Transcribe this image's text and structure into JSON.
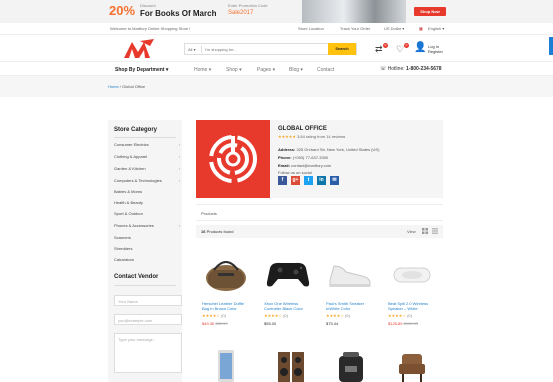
{
  "promo": {
    "percent": "20%",
    "discount": "Discount",
    "headline": "For Books Of March",
    "enter_code": "Enter Promotion Code",
    "code": "Sale2017",
    "shop_now": "Shop Now"
  },
  "topbar": {
    "welcome": "Welcome to Martfury Online Shopping Store !",
    "store_location": "Store Location",
    "track_order": "Track Your Order",
    "currency": "US Dollar",
    "language": "English"
  },
  "header": {
    "search_category": "All",
    "search_placeholder": "I'm shopping for...",
    "search_button": "Search",
    "compare_count": "0",
    "wishlist_count": "0",
    "login": "Log In",
    "register": "Register"
  },
  "nav": {
    "dept": "Shop By Department",
    "items": [
      "Home",
      "Shop",
      "Pages",
      "Blog",
      "Contact"
    ],
    "hotline_label": "Hotline:",
    "hotline": "1-800-234-5678"
  },
  "breadcrumb": {
    "home": "Home",
    "current": "Global Office"
  },
  "sidebar": {
    "category_title": "Store Category",
    "categories": [
      {
        "label": "Consumer Electrics",
        "chevron": true
      },
      {
        "label": "Clothing & Apparel",
        "chevron": true
      },
      {
        "label": "Garden & Kitchen",
        "chevron": true
      },
      {
        "label": "Computers & Technologies",
        "chevron": true
      },
      {
        "label": "Babies & Moms",
        "chevron": false
      },
      {
        "label": "Health & Beauty",
        "chevron": false
      },
      {
        "label": "Sport & Outdoor",
        "chevron": false
      },
      {
        "label": "Phones & Accessories",
        "chevron": true
      },
      {
        "label": "Scanners",
        "chevron": false
      },
      {
        "label": "Shredders",
        "chevron": false
      },
      {
        "label": "Calculators",
        "chevron": false
      }
    ],
    "vendor_title": "Contact Vendor",
    "name_placeholder": "Your Name",
    "email_placeholder": "you@example.com",
    "message_placeholder": "Type your message..."
  },
  "store": {
    "name": "GLOBAL OFFICE",
    "stars": "★★★★★",
    "rating": "3.84 rating from 14 reviews",
    "address_label": "Address:",
    "address": "325 Orchard Str, New York, United States (US)",
    "phone_label": "Phone:",
    "phone": "(+053) 77-637-3300",
    "email_label": "Email:",
    "email": "contact@martfury.com",
    "follow": "Follow us on social"
  },
  "social": [
    {
      "icon": "facebook-icon",
      "glyph": "f",
      "color": "#3b5998"
    },
    {
      "icon": "googleplus-icon",
      "glyph": "g+",
      "color": "#dd4b39"
    },
    {
      "icon": "twitter-icon",
      "glyph": "t",
      "color": "#1da1f2"
    },
    {
      "icon": "linkedin-icon",
      "glyph": "in",
      "color": "#0e76a8"
    },
    {
      "icon": "feed-icon",
      "glyph": "✉",
      "color": "#2a5ea8"
    }
  ],
  "products": {
    "tab": "Products",
    "count_num": "16",
    "count_text": "Products found",
    "view": "View",
    "items": [
      {
        "name": "Herschel Leather Duffle Bag In Brown Color",
        "stars": "★★★★☆",
        "reviews": "(0)",
        "price": "$49.30",
        "old": "$52.99",
        "icon": "duffle-bag-icon"
      },
      {
        "name": "Xbox One Wireless Controller Black Color",
        "stars": "★★★★☆",
        "reviews": "(0)",
        "price": "$55.00",
        "old": "",
        "icon": "game-controller-icon"
      },
      {
        "name": "Paul's Smith Sneaker InWhite Color",
        "stars": "★★★★☆",
        "reviews": "(0)",
        "price": "$75.44",
        "old": "",
        "icon": "sneaker-icon"
      },
      {
        "name": "Beat Spill 2.0 Wireless Speaker – White",
        "stars": "★★★★☆",
        "reviews": "(0)",
        "price": "$125.89",
        "old": "$160.99",
        "icon": "speaker-icon"
      }
    ]
  },
  "colors": {
    "brand": "#e8392d",
    "accent": "#ffc30f",
    "link": "#1e7ec8"
  }
}
